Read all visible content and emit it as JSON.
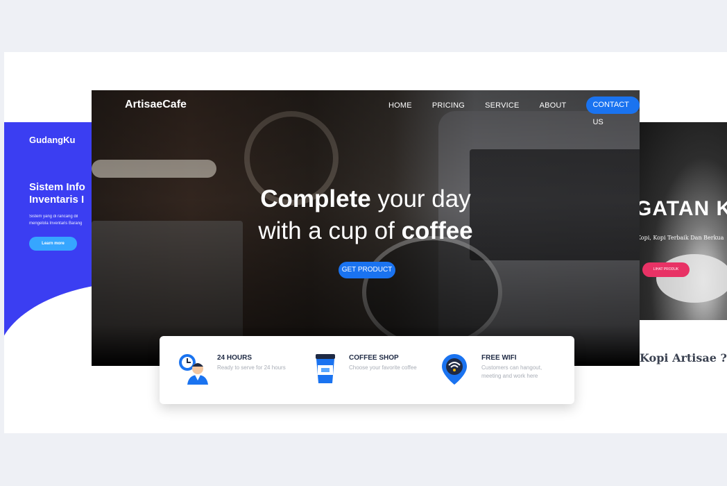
{
  "left_card": {
    "brand": "GudangKu",
    "title": "Sistem Info\nInventaris I",
    "text": "Sistem yang di rancang dil\nmengelola Inventaris Barang",
    "button": "Learn more",
    "accent": "#3b3ef2"
  },
  "right_card": {
    "title": "GATAN KO",
    "subtitle": "Kopi, Kopi Terbaik Dan Berkua",
    "button": "LIHAT PRODUK",
    "question": "Kopi Artisae ?",
    "accent": "#e83265"
  },
  "main": {
    "brand": "ArtisaeCafe",
    "nav": [
      "HOME",
      "PRICING",
      "SERVICE",
      "ABOUT"
    ],
    "nav_cta": "CONTACT US",
    "headline_line1_bold": "Complete",
    "headline_line1_rest": " your day",
    "headline_line2_rest": "with a cup of ",
    "headline_line2_bold": "coffee",
    "cta": "GET PRODUCT",
    "accent": "#1a73f0"
  },
  "features": [
    {
      "icon": "clock-person-icon",
      "title": "24 HOURS",
      "desc": "Ready to serve for 24 hours"
    },
    {
      "icon": "coffee-cup-icon",
      "title": "COFFEE SHOP",
      "desc": "Choose your favorite coffee"
    },
    {
      "icon": "wifi-pin-icon",
      "title": "FREE WIFI",
      "desc": "Customers can hangout, meeting and work here"
    }
  ]
}
